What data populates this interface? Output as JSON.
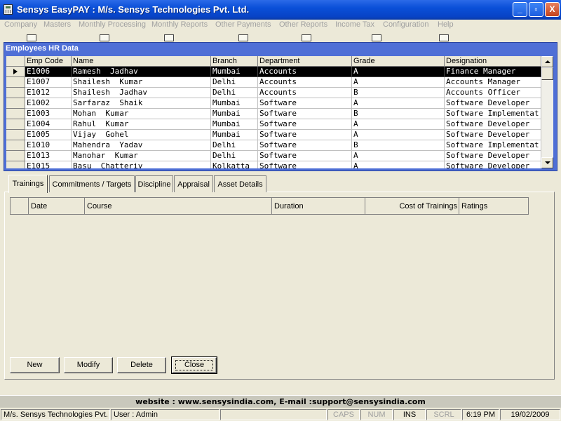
{
  "window": {
    "title": "Sensys EasyPAY : M/s. Sensys Technologies Pvt. Ltd.",
    "buttons": {
      "minimize": "_",
      "maximize": "▫",
      "close": "X"
    }
  },
  "menu": [
    "Company",
    "Masters",
    "Monthly Processing",
    "Monthly Reports",
    "Other Payments",
    "Other Reports",
    "Income Tax",
    "Configuration",
    "Help"
  ],
  "hr_window": {
    "caption": "Employees HR Data",
    "columns": [
      "Emp Code",
      "Name",
      "Branch",
      "Department",
      "Grade",
      "Designation"
    ],
    "rows": [
      [
        "E1006",
        "Ramesh  Jadhav",
        "Mumbai",
        "Accounts",
        "A",
        "Finance Manager"
      ],
      [
        "E1007",
        "Shailesh  Kumar",
        "Delhi",
        "Accounts",
        "A",
        "Accounts Manager"
      ],
      [
        "E1012",
        "Shailesh  Jadhav",
        "Delhi",
        "Accounts",
        "B",
        "Accounts Officer"
      ],
      [
        "E1002",
        "Sarfaraz  Shaik",
        "Mumbai",
        "Software",
        "A",
        "Software Developer"
      ],
      [
        "E1003",
        "Mohan  Kumar",
        "Mumbai",
        "Software",
        "B",
        "Software Implementat"
      ],
      [
        "E1004",
        "Rahul  Kumar",
        "Mumbai",
        "Software",
        "A",
        "Software Developer"
      ],
      [
        "E1005",
        "Vijay  Gohel",
        "Mumbai",
        "Software",
        "A",
        "Software Developer"
      ],
      [
        "E1010",
        "Mahendra  Yadav",
        "Delhi",
        "Software",
        "B",
        "Software Implementat"
      ],
      [
        "E1013",
        "Manohar  Kumar",
        "Delhi",
        "Software",
        "A",
        "Software Developer"
      ],
      [
        "E1015",
        "Basu  Chatteriy",
        "Kolkatta",
        "Software",
        "A",
        "Software Developer"
      ]
    ],
    "selected_row": 0
  },
  "tabs": [
    "Trainings",
    "Commitments / Targets",
    "Discipline",
    "Appraisal",
    "Asset Details"
  ],
  "active_tab": 0,
  "trainings_grid": {
    "columns": [
      "Date",
      "Course",
      "Duration",
      "Cost of Trainings",
      "Ratings"
    ]
  },
  "actions": {
    "new": "New",
    "modify": "Modify",
    "delete": "Delete",
    "close": "Close"
  },
  "footer": {
    "contact": "website : www.sensysindia.com, E-mail :support@sensysindia.com"
  },
  "status": {
    "company": "M/s. Sensys Technologies Pvt.",
    "user": "User : Admin",
    "caps": "CAPS",
    "num": "NUM",
    "ins": "INS",
    "scrl": "SCRL",
    "time": "6:19 PM",
    "date": "19/02/2009"
  }
}
